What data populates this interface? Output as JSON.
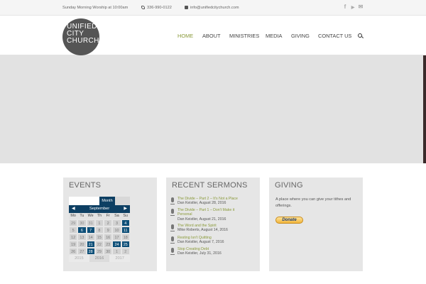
{
  "topbar": {
    "worship": "Sunday Morning Worship at 10:00am",
    "phone": "336-990-0122",
    "email": "info@unifiedcitychurch.com",
    "social": [
      "f",
      "▶",
      "✉"
    ]
  },
  "logo": {
    "lines": [
      "UNIFIED",
      "CITY",
      "CHURCH"
    ]
  },
  "nav": {
    "items": [
      "HOME",
      "ABOUT",
      "MINISTRIES",
      "MEDIA",
      "GIVING",
      "CONTACT US"
    ],
    "active": "HOME",
    "accent": "#8a9a3a"
  },
  "events": {
    "title": "EVENTS",
    "view_label": "Month",
    "month": "September",
    "prev": "◀",
    "next": "▶",
    "days": [
      "Mo",
      "Tu",
      "We",
      "Th",
      "Fr",
      "Sa",
      "Su"
    ],
    "weeks": [
      [
        "29",
        "30",
        "31",
        "1",
        "2",
        "3",
        "4"
      ],
      [
        "5",
        "6",
        "7",
        "8",
        "9",
        "10",
        "11"
      ],
      [
        "12",
        "13",
        "14",
        "15",
        "16",
        "17",
        "18"
      ],
      [
        "19",
        "20",
        "21",
        "22",
        "23",
        "24",
        "25"
      ],
      [
        "26",
        "27",
        "28",
        "29",
        "30",
        "1",
        "2"
      ]
    ],
    "event_days": [
      "4",
      "6",
      "7",
      "11",
      "21",
      "24",
      "25",
      "28"
    ],
    "years": [
      "2015",
      "2016",
      "2017"
    ],
    "accent": "#0d3f63"
  },
  "sermons": {
    "title": "RECENT SERMONS",
    "items": [
      {
        "title": "The Divide – Part 2 – It's Not a Place",
        "meta": "Dan Keistler, August 28, 2016"
      },
      {
        "title": "The Divide – Part 1 – Don't Make it Personal",
        "meta": "Dan Keistler, August 21, 2016"
      },
      {
        "title": "The Word and the Spirit",
        "meta": "Mike Roberts, August 14, 2016"
      },
      {
        "title": "Resting Isn't Quitting",
        "meta": "Dan Keistler, August 7, 2016"
      },
      {
        "title": "Stop Creating Debt",
        "meta": "Dan Keistler, July 31, 2016"
      }
    ]
  },
  "giving": {
    "title": "GIVING",
    "text": "A place where you can give your tithes and offerings.",
    "donate_label": "Donate"
  }
}
